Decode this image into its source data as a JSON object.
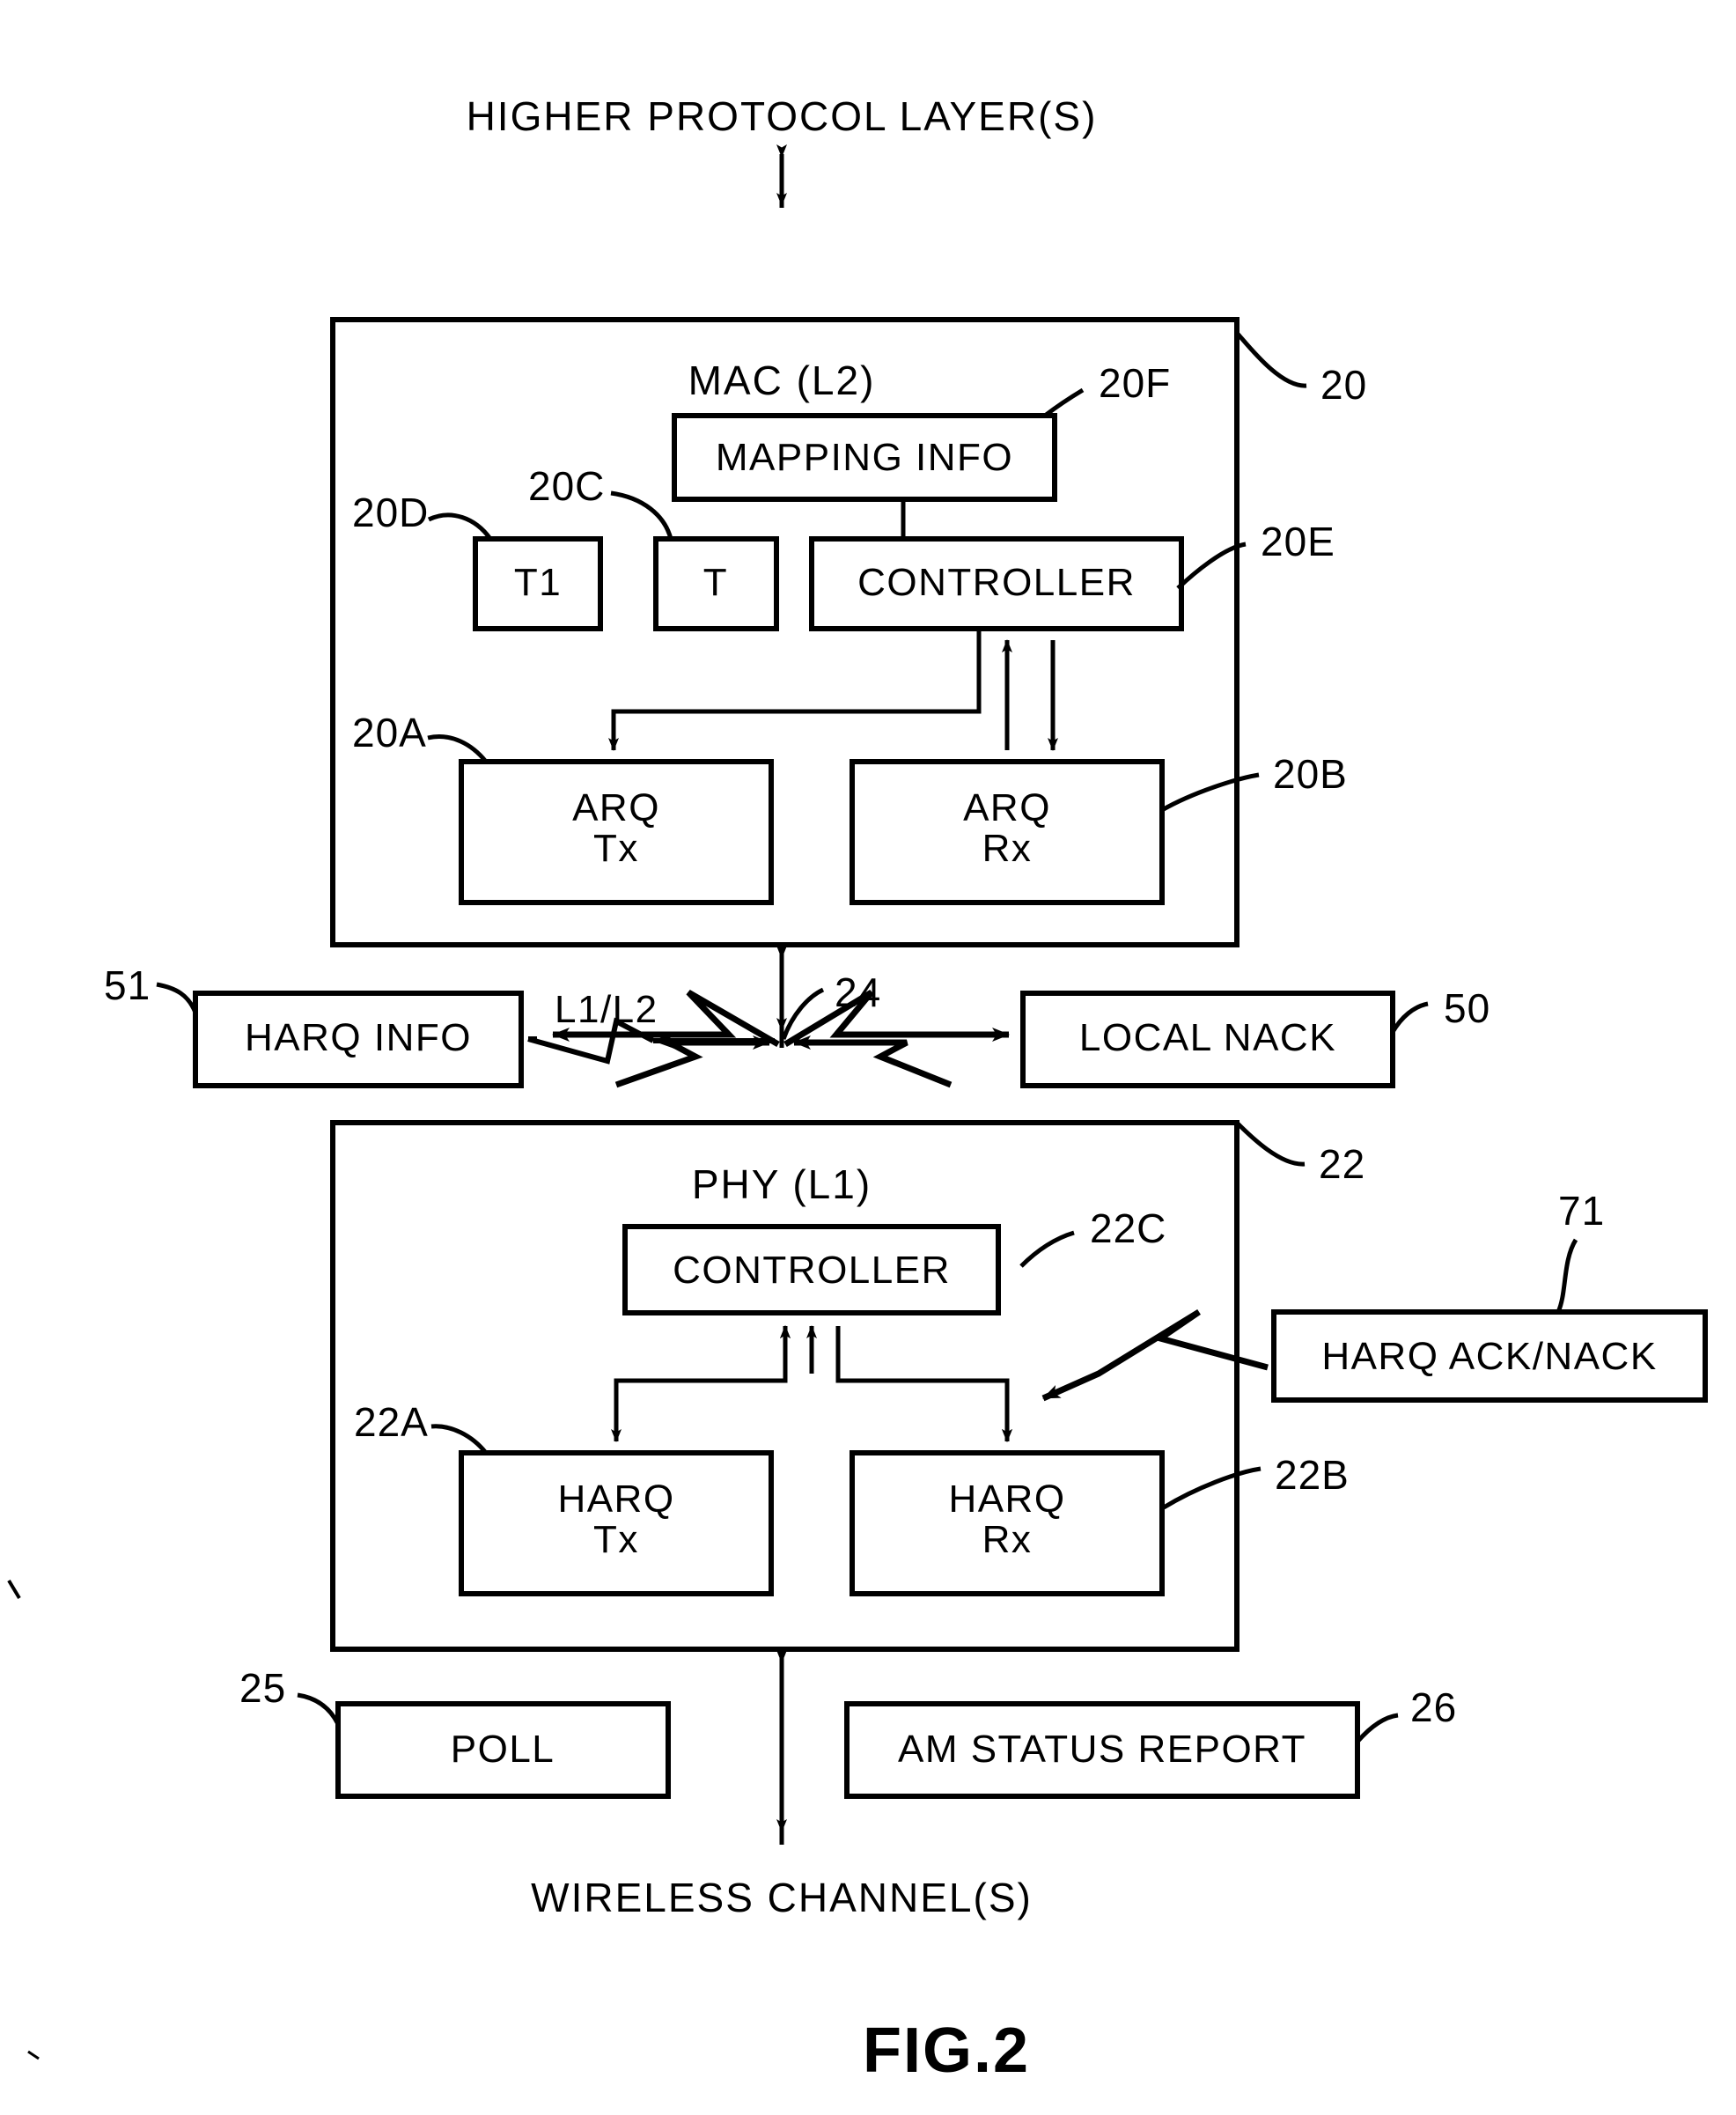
{
  "figure": {
    "title": "FIG.2",
    "top_label": "HIGHER PROTOCOL LAYER(S)",
    "bottom_label": "WIRELESS CHANNEL(S)",
    "interface_label": "L1/L2"
  },
  "mac_layer": {
    "name": "MAC (L2)",
    "ref": "20",
    "blocks": [
      {
        "id": "20F",
        "label": "MAPPING INFO",
        "ref": "20F"
      },
      {
        "id": "20D",
        "label": "T1",
        "ref": "20D"
      },
      {
        "id": "20C",
        "label": "T",
        "ref": "20C"
      },
      {
        "id": "20E",
        "label": "CONTROLLER",
        "ref": "20E"
      },
      {
        "id": "20A",
        "label_line1": "ARQ",
        "label_line2": "Tx",
        "ref": "20A"
      },
      {
        "id": "20B",
        "label_line1": "ARQ",
        "label_line2": "Rx",
        "ref": "20B"
      }
    ]
  },
  "phy_layer": {
    "name": "PHY (L1)",
    "ref": "22",
    "blocks": [
      {
        "id": "22C",
        "label": "CONTROLLER",
        "ref": "22C"
      },
      {
        "id": "22A",
        "label_line1": "HARQ",
        "label_line2": "Tx",
        "ref": "22A"
      },
      {
        "id": "22B",
        "label_line1": "HARQ",
        "label_line2": "Rx",
        "ref": "22B"
      }
    ]
  },
  "external_blocks": [
    {
      "id": "51",
      "label": "HARQ INFO",
      "ref": "51"
    },
    {
      "id": "50",
      "label": "LOCAL NACK",
      "ref": "50"
    },
    {
      "id": "71",
      "label": "HARQ ACK/NACK",
      "ref": "71"
    },
    {
      "id": "25",
      "label": "POLL",
      "ref": "25"
    },
    {
      "id": "26",
      "label": "AM STATUS REPORT",
      "ref": "26"
    }
  ],
  "interface_ref": "24",
  "colors": {
    "ink": "#000000",
    "paper": "#ffffff"
  }
}
